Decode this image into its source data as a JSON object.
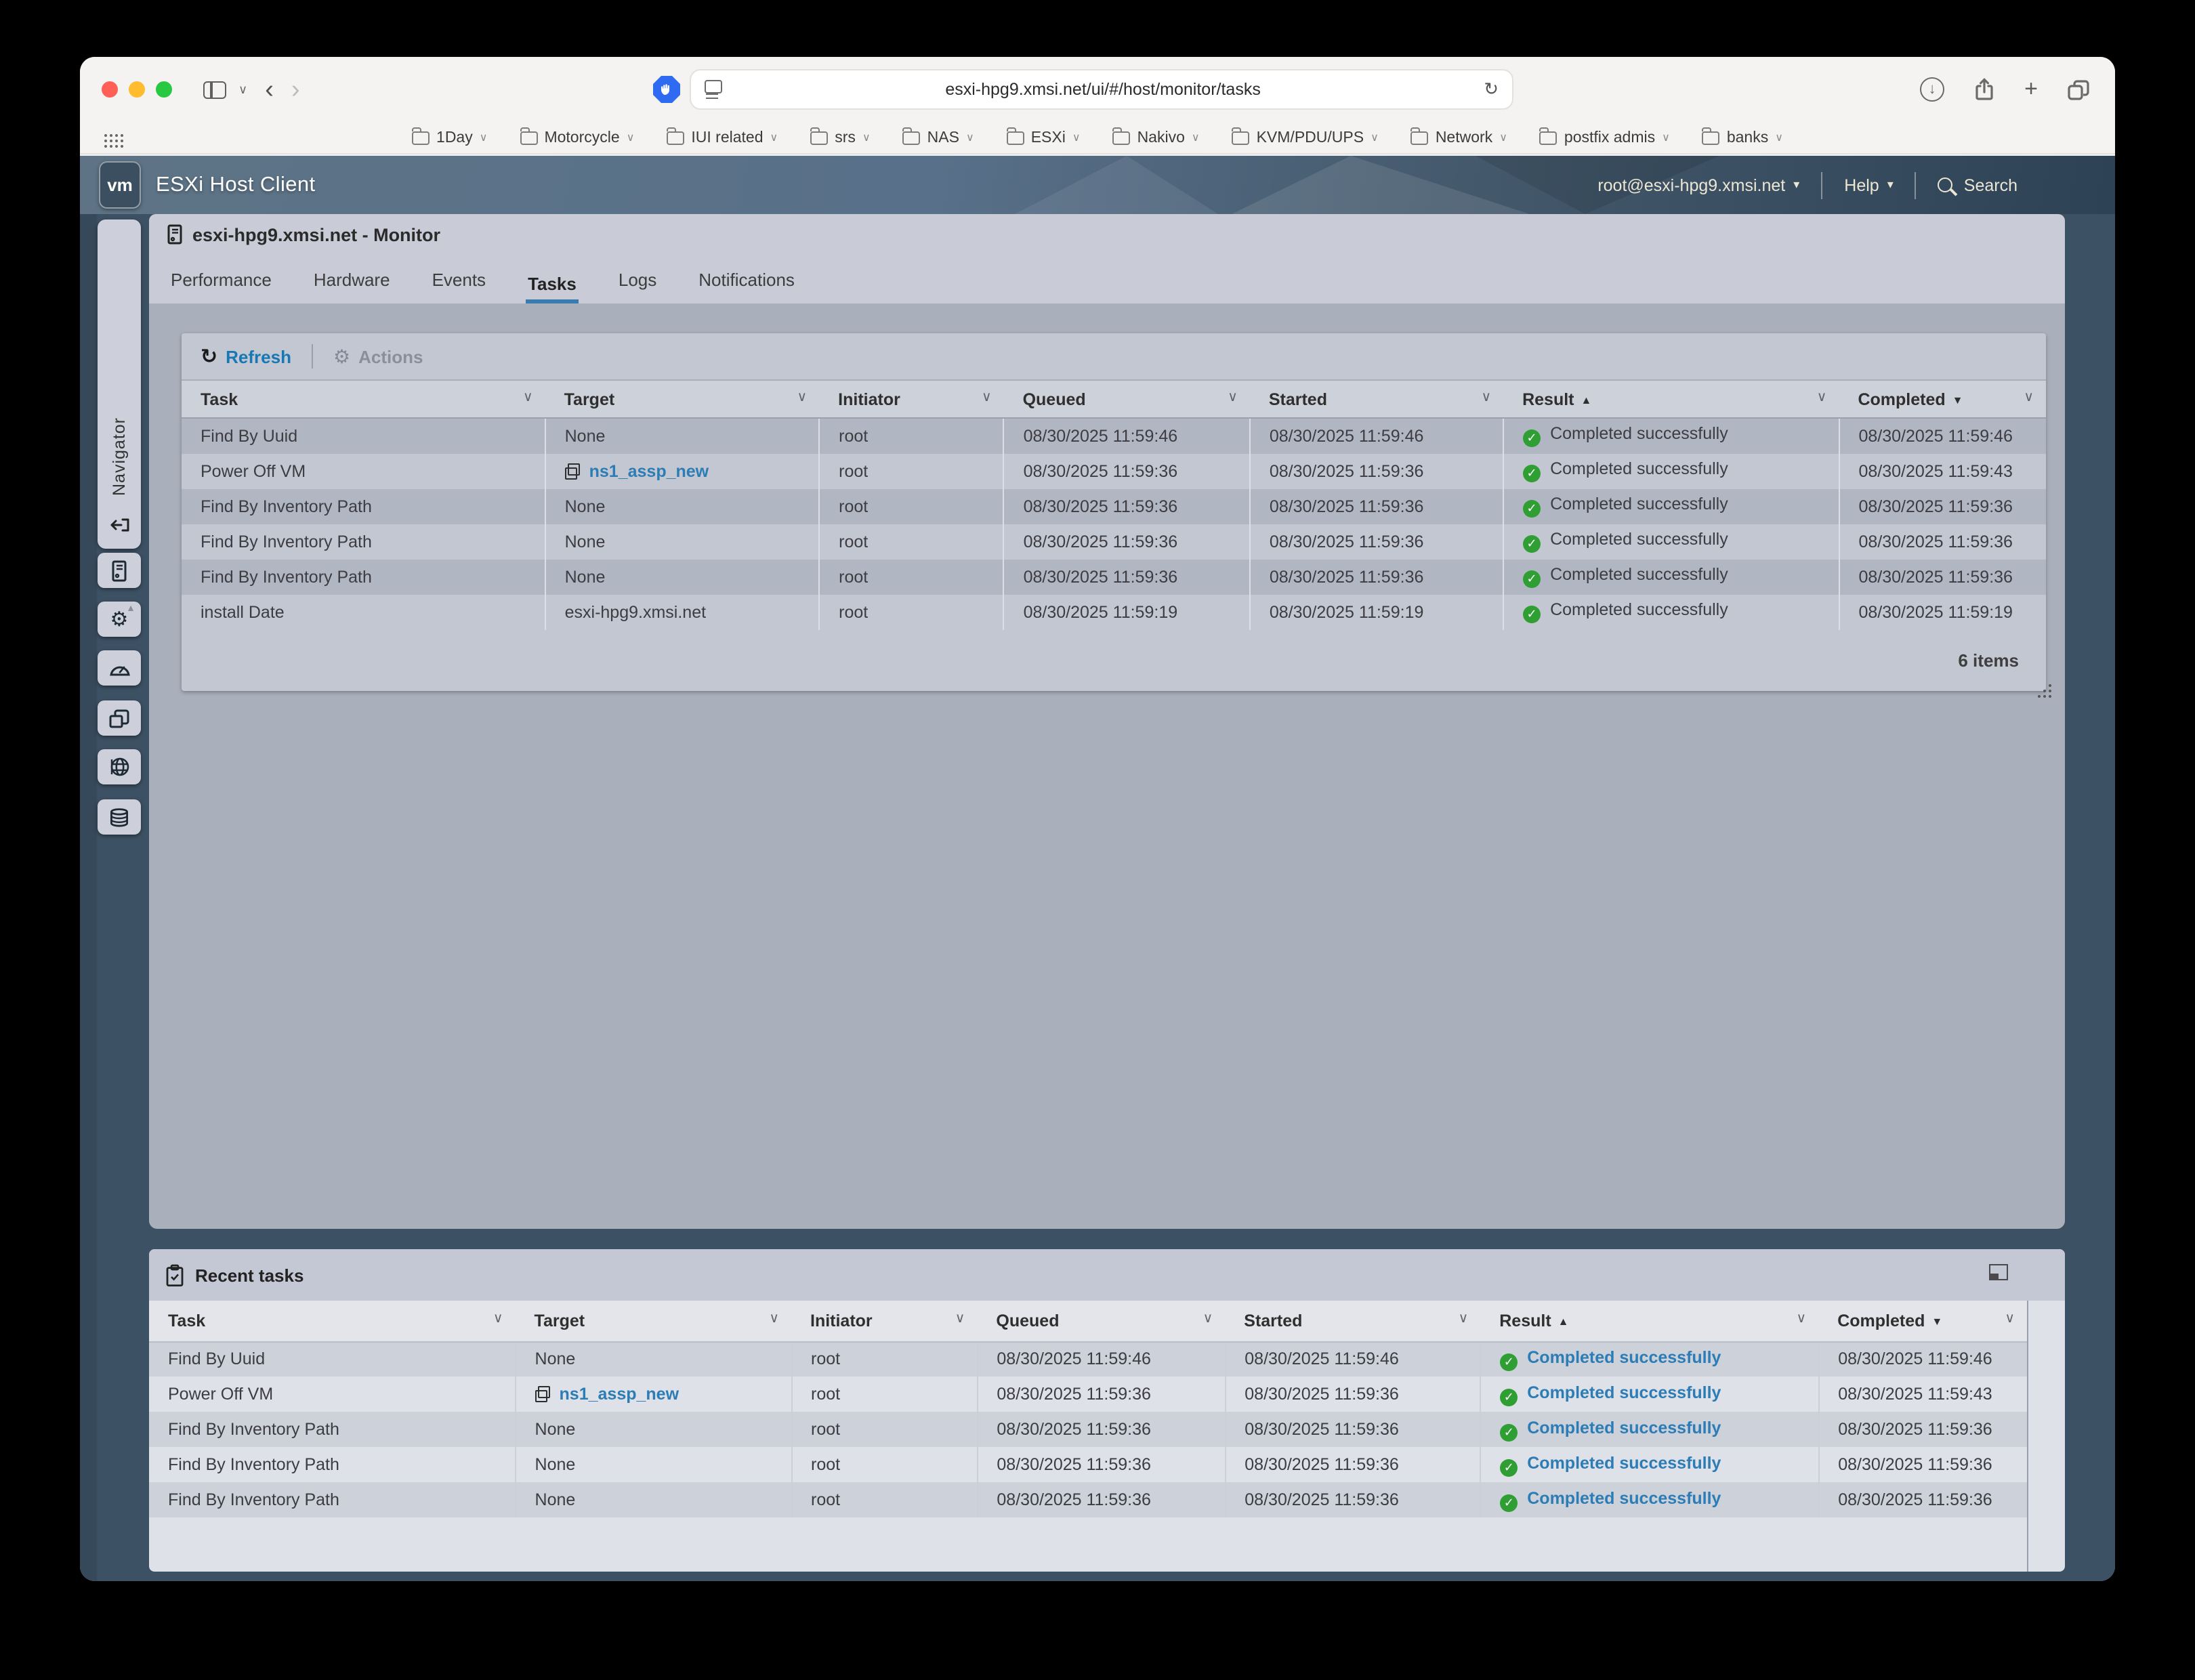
{
  "icons": {
    "chevron_down": "∨",
    "caret_down": "▾",
    "sort_asc": "▲",
    "sort_desc": "▼",
    "check": "✓",
    "back": "‹",
    "forward": "›",
    "reload": "↻",
    "refresh": "↻",
    "gear": "⚙",
    "plus": "+",
    "download_arrow": "↓",
    "vm_logo_text": "vm"
  },
  "colors": {
    "accent_blue": "#1778b3",
    "tab_underline": "#3a7cb0",
    "success_green": "#2f9e33",
    "link_blue": "#2c7cb5",
    "app_teal": "#3d5164"
  },
  "browser": {
    "url": "esxi-hpg9.xmsi.net/ui/#/host/monitor/tasks",
    "bookmarks": [
      "1Day",
      "Motorcycle",
      "IUI related",
      "srs",
      "NAS",
      "ESXi",
      "Nakivo",
      "KVM/PDU/UPS",
      "Network",
      "postfix admis",
      "banks"
    ]
  },
  "app": {
    "product": "ESXi Host Client",
    "user": "root@esxi-hpg9.xmsi.net",
    "help": "Help",
    "search": "Search",
    "navigator": "Navigator"
  },
  "monitor": {
    "title": "esxi-hpg9.xmsi.net - Monitor",
    "tabs": [
      "Performance",
      "Hardware",
      "Events",
      "Tasks",
      "Logs",
      "Notifications"
    ],
    "active_tab": "Tasks",
    "refresh": "Refresh",
    "actions": "Actions",
    "items_count": "6 items"
  },
  "table": {
    "columns": [
      "Task",
      "Target",
      "Initiator",
      "Queued",
      "Started",
      "Result",
      "Completed"
    ],
    "col_widths": [
      "19.5%",
      "14.7%",
      "9.9%",
      "13.2%",
      "13.6%",
      "18.0%",
      "11.1%"
    ],
    "sort": {
      "Result": "asc",
      "Completed": "desc"
    },
    "rows": [
      {
        "task": "Find By Uuid",
        "target": "None",
        "vm_link": false,
        "initiator": "root",
        "queued": "08/30/2025 11:59:46",
        "started": "08/30/2025 11:59:46",
        "result": "Completed successfully",
        "completed": "08/30/2025 11:59:46"
      },
      {
        "task": "Power Off VM",
        "target": "ns1_assp_new",
        "vm_link": true,
        "initiator": "root",
        "queued": "08/30/2025 11:59:36",
        "started": "08/30/2025 11:59:36",
        "result": "Completed successfully",
        "completed": "08/30/2025 11:59:43"
      },
      {
        "task": "Find By Inventory Path",
        "target": "None",
        "vm_link": false,
        "initiator": "root",
        "queued": "08/30/2025 11:59:36",
        "started": "08/30/2025 11:59:36",
        "result": "Completed successfully",
        "completed": "08/30/2025 11:59:36"
      },
      {
        "task": "Find By Inventory Path",
        "target": "None",
        "vm_link": false,
        "initiator": "root",
        "queued": "08/30/2025 11:59:36",
        "started": "08/30/2025 11:59:36",
        "result": "Completed successfully",
        "completed": "08/30/2025 11:59:36"
      },
      {
        "task": "Find By Inventory Path",
        "target": "None",
        "vm_link": false,
        "initiator": "root",
        "queued": "08/30/2025 11:59:36",
        "started": "08/30/2025 11:59:36",
        "result": "Completed successfully",
        "completed": "08/30/2025 11:59:36"
      },
      {
        "task": "install Date",
        "target": "esxi-hpg9.xmsi.net",
        "vm_link": false,
        "initiator": "root",
        "queued": "08/30/2025 11:59:19",
        "started": "08/30/2025 11:59:19",
        "result": "Completed successfully",
        "completed": "08/30/2025 11:59:19"
      }
    ]
  },
  "recent": {
    "title": "Recent tasks",
    "visible_rows": 5
  }
}
